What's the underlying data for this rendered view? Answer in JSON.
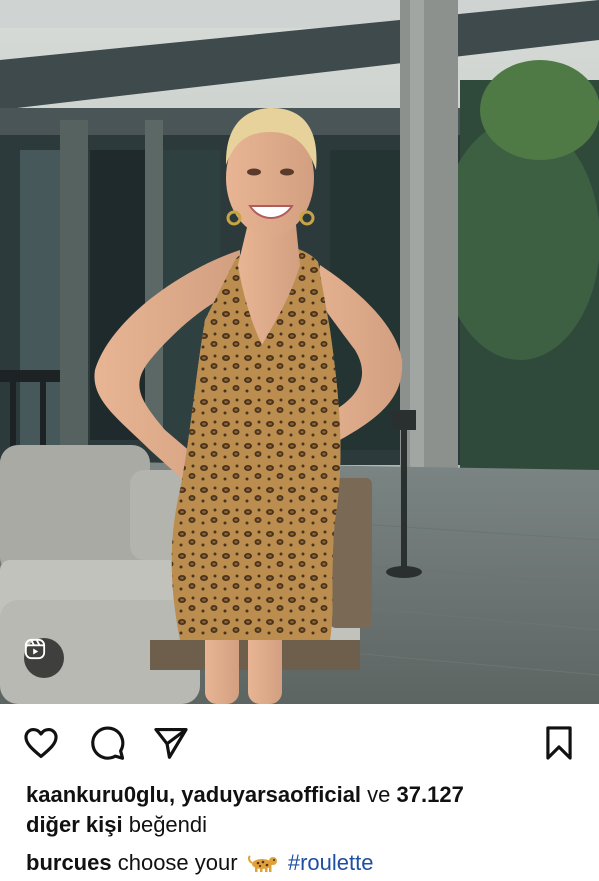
{
  "post": {
    "media": {
      "type": "reel",
      "badge_icon": "reels-icon"
    },
    "actions": {
      "like_icon": "heart-outline-icon",
      "comment_icon": "comment-bubble-icon",
      "share_icon": "paper-plane-icon",
      "save_icon": "bookmark-outline-icon"
    },
    "likes": {
      "user_1": "kaankuru0glu",
      "separator": ",",
      "user_2": "yaduyarsaofficial",
      "conjunction": "ve",
      "count": "37.127",
      "others": "diğer kişi",
      "verb": "beğendi"
    },
    "caption": {
      "username": "burcues",
      "text": "choose your",
      "emoji": "leopard-emoji",
      "hashtag": "#roulette"
    }
  }
}
